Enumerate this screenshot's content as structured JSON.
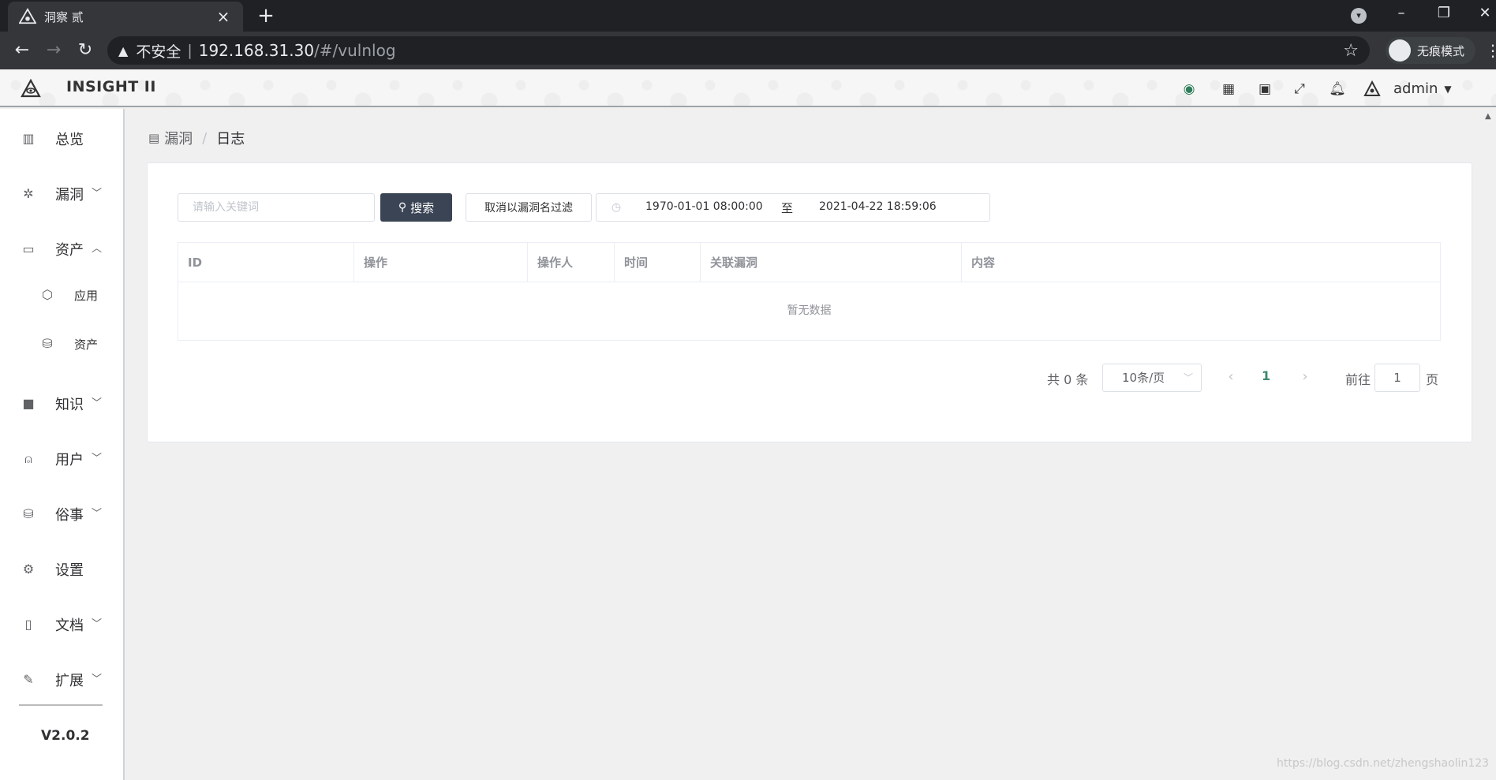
{
  "browser": {
    "tab_title": "洞察 贰",
    "tab_close": "×",
    "new_tab": "+",
    "security_label": "不安全",
    "separator": "|",
    "url_host": "192.168.31.30",
    "url_path": "/#/vulnlog",
    "incognito_label": "无痕模式"
  },
  "header": {
    "brand": "INSIGHT II",
    "user": "admin"
  },
  "sidebar": {
    "items": [
      {
        "label": "总览",
        "icon": "bar-chart-icon"
      },
      {
        "label": "漏洞",
        "icon": "bug-icon"
      },
      {
        "label": "资产",
        "icon": "folder-icon"
      },
      {
        "label": "知识",
        "icon": "book-icon"
      },
      {
        "label": "用户",
        "icon": "user-icon"
      },
      {
        "label": "俗事",
        "icon": "database-icon"
      },
      {
        "label": "设置",
        "icon": "settings-icon"
      },
      {
        "label": "文档",
        "icon": "document-icon"
      },
      {
        "label": "扩展",
        "icon": "wrench-icon"
      }
    ],
    "sub_items": [
      {
        "label": "应用",
        "icon": "cube-icon"
      },
      {
        "label": "资产",
        "icon": "database-icon"
      }
    ],
    "version": "V2.0.2"
  },
  "breadcrumb": {
    "parent": "漏洞",
    "separator": "/",
    "current": "日志"
  },
  "toolbar": {
    "search_placeholder": "请输入关键词",
    "search_button": "搜索",
    "cancel_filter_button": "取消以漏洞名过滤",
    "date_start": "1970-01-01 08:00:00",
    "date_to": "至",
    "date_end": "2021-04-22 18:59:06"
  },
  "table": {
    "columns": [
      "ID",
      "操作",
      "操作人",
      "时间",
      "关联漏洞",
      "内容"
    ],
    "empty_text": "暂无数据"
  },
  "pagination": {
    "total": "共 0 条",
    "page_size": "10条/页",
    "current_page": "1",
    "goto_label": "前往",
    "goto_value": "1",
    "page_suffix": "页"
  },
  "watermark": "https://blog.csdn.net/zhengshaolin123",
  "colors": {
    "primary_button": "#3a4454",
    "active_page": "#3a8a6e"
  }
}
